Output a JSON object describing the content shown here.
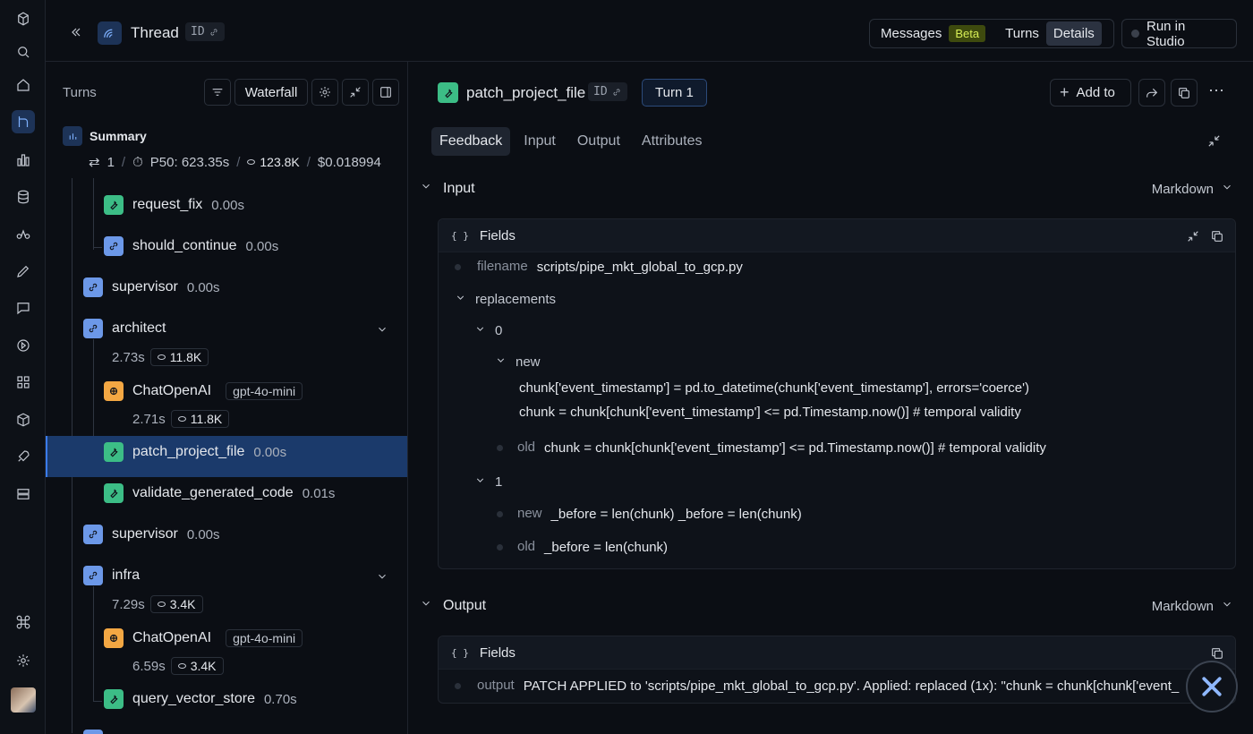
{
  "header": {
    "title": "Thread",
    "id_label": "ID",
    "view_tabs": [
      {
        "label": "Messages",
        "badge": "Beta"
      },
      {
        "label": "Turns"
      },
      {
        "label": "Details"
      }
    ],
    "run_in_studio": "Run in Studio"
  },
  "left": {
    "title": "Turns",
    "waterfall_label": "Waterfall",
    "summary": {
      "label": "Summary",
      "turns": "1",
      "p50": "P50: 623.35s",
      "tokens": "123.8K",
      "cost": "$0.018994"
    },
    "nodes": [
      {
        "name": "request_fix",
        "dur": "0.00s"
      },
      {
        "name": "should_continue",
        "dur": "0.00s"
      },
      {
        "name": "supervisor",
        "dur": "0.00s"
      },
      {
        "name": "architect",
        "meta_time": "2.73s",
        "meta_tok": "11.8K"
      },
      {
        "name": "ChatOpenAI",
        "model": "gpt-4o-mini",
        "meta_time": "2.71s",
        "meta_tok": "11.8K"
      },
      {
        "name": "patch_project_file",
        "dur": "0.00s"
      },
      {
        "name": "validate_generated_code",
        "dur": "0.01s"
      },
      {
        "name": "supervisor",
        "dur": "0.00s"
      },
      {
        "name": "infra",
        "meta_time": "7.29s",
        "meta_tok": "3.4K"
      },
      {
        "name": "ChatOpenAI",
        "model": "gpt-4o-mini",
        "meta_time": "6.59s",
        "meta_tok": "3.4K"
      },
      {
        "name": "query_vector_store",
        "dur": "0.70s"
      }
    ]
  },
  "detail": {
    "title": "patch_project_file",
    "id_label": "ID",
    "turn_label": "Turn 1",
    "add_to": "Add to",
    "tabs": [
      "Feedback",
      "Input",
      "Output",
      "Attributes"
    ],
    "input": {
      "section": "Input",
      "format": "Markdown",
      "fields_label": "Fields",
      "filename_key": "filename",
      "filename_val": "scripts/pipe_mkt_global_to_gcp.py",
      "replacements_key": "replacements",
      "idx0": "0",
      "new_key": "new",
      "new0_line1": "chunk['event_timestamp'] = pd.to_datetime(chunk['event_timestamp'], errors='coerce')",
      "new0_line2": "chunk = chunk[chunk['event_timestamp'] <= pd.Timestamp.now()]  # temporal validity",
      "old_key": "old",
      "old0": "chunk = chunk[chunk['event_timestamp'] <= pd.Timestamp.now()] # temporal validity",
      "idx1": "1",
      "new1": "_before = len(chunk) _before = len(chunk)",
      "old1": "_before = len(chunk)"
    },
    "output": {
      "section": "Output",
      "format": "Markdown",
      "fields_label": "Fields",
      "output_key": "output",
      "output_val": "PATCH APPLIED to 'scripts/pipe_mkt_global_to_gcp.py'. Applied: replaced (1x): \"chunk = chunk[chunk['event_"
    }
  }
}
